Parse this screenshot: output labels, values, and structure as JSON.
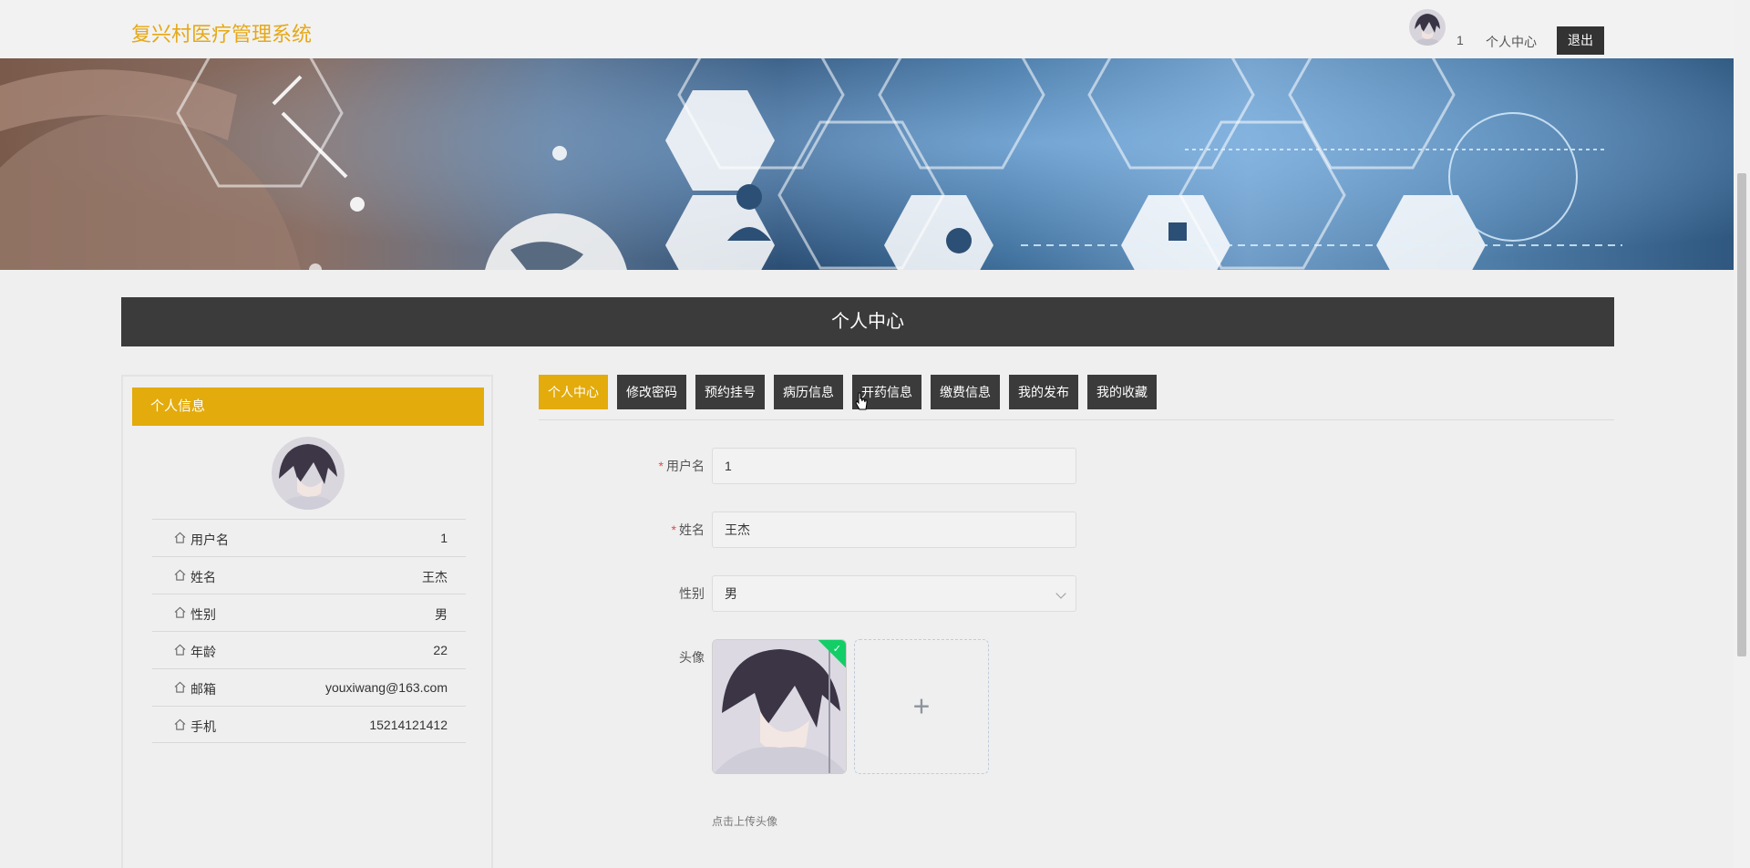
{
  "header": {
    "logo": "复兴村医疗管理系统",
    "username": "1",
    "personal_center": "个人中心",
    "logout": "退出"
  },
  "banner": {
    "slides": 3,
    "active_slide": 3
  },
  "section": {
    "title": "个人中心"
  },
  "profile": {
    "panel_title": "个人信息",
    "fields": [
      {
        "label": "用户名",
        "value": "1"
      },
      {
        "label": "姓名",
        "value": "王杰"
      },
      {
        "label": "性别",
        "value": "男"
      },
      {
        "label": "年龄",
        "value": "22"
      },
      {
        "label": "邮箱",
        "value": "youxiwang@163.com"
      },
      {
        "label": "手机",
        "value": "15214121412"
      }
    ]
  },
  "tabs": [
    {
      "label": "个人中心",
      "active": true
    },
    {
      "label": "修改密码",
      "active": false
    },
    {
      "label": "预约挂号",
      "active": false
    },
    {
      "label": "病历信息",
      "active": false
    },
    {
      "label": "开药信息",
      "active": false
    },
    {
      "label": "缴费信息",
      "active": false
    },
    {
      "label": "我的发布",
      "active": false
    },
    {
      "label": "我的收藏",
      "active": false
    }
  ],
  "form": {
    "username_label": "用户名",
    "username_value": "1",
    "name_label": "姓名",
    "name_value": "王杰",
    "gender_label": "性别",
    "gender_value": "男",
    "avatar_label": "头像",
    "upload_plus": "+",
    "upload_tip": "点击上传头像",
    "required_mark": "*"
  },
  "colors": {
    "accent": "#e3ab0b",
    "dark": "#3b3b3b",
    "success": "#13ce66",
    "required": "#e34b4b"
  }
}
